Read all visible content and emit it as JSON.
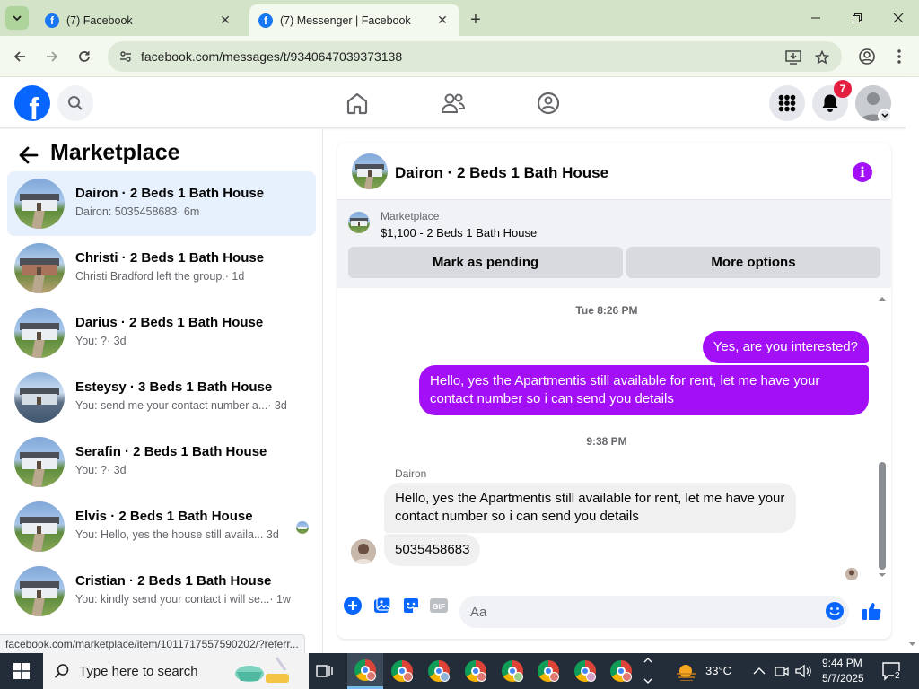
{
  "browser": {
    "tabs": [
      {
        "title": "(7) Facebook",
        "active": false
      },
      {
        "title": "(7) Messenger | Facebook",
        "active": true
      }
    ],
    "url_host": "facebook.com",
    "url_path": "/messages/t/9340647039373138",
    "status_url": "facebook.com/marketplace/item/1011717557590202/?referr..."
  },
  "fb_header": {
    "logo_letter": "f",
    "notifications_count": "7"
  },
  "left_panel": {
    "title": "Marketplace",
    "conversations": [
      {
        "name": "Dairon · 2 Beds 1 Bath House",
        "preview": "Dairon: 5035458683",
        "time": "· 6m",
        "active": true,
        "thumb": "house"
      },
      {
        "name": "Christi · 2 Beds 1 Bath House",
        "preview": "Christi Bradford left the group.",
        "time": "· 1d",
        "active": false,
        "thumb": "house-brown"
      },
      {
        "name": "Darius · 2 Beds 1 Bath House",
        "preview": "You: ?",
        "time": "· 3d",
        "active": false,
        "thumb": "house"
      },
      {
        "name": "Esteysy · 3 Beds 1 Bath House",
        "preview": "You: send me your contact number a...",
        "time": "· 3d",
        "active": false,
        "thumb": "house-pool"
      },
      {
        "name": "Serafin · 2 Beds 1 Bath House",
        "preview": "You: ?",
        "time": "· 3d",
        "active": false,
        "thumb": "house"
      },
      {
        "name": "Elvis · 2 Beds 1 Bath House",
        "preview": "You: Hello, yes the house still availa...",
        "time": "3d",
        "active": false,
        "thumb": "house"
      },
      {
        "name": "Cristian · 2 Beds 1 Bath House",
        "preview": "You: kindly send your contact i will se...",
        "time": "· 1w",
        "active": false,
        "thumb": "house"
      }
    ]
  },
  "chat": {
    "title": "Dairon · 2 Beds 1 Bath House",
    "listing_category": "Marketplace",
    "listing_title": "$1,100 - 2 Beds 1 Bath House",
    "mark_pending_label": "Mark as pending",
    "more_options_label": "More options",
    "timestamp_1": "Tue 8:26 PM",
    "msg_out_1": "Yes, are you interested?",
    "msg_out_2": "Hello, yes the Apartmentis still available for rent, let me have your contact number so i can send you  details",
    "timestamp_2": "9:38 PM",
    "sender_name": "Dairon",
    "msg_in_1": "Hello, yes the Apartmentis still available for rent, let me have your contact number so i can send you  details",
    "msg_in_2": "5035458683",
    "input_placeholder": "Aa",
    "gif_label": "GIF",
    "accent_color": "#a30ff7"
  },
  "taskbar": {
    "search_placeholder": "Type here to search",
    "temperature": "33°C",
    "time": "9:44 PM",
    "date": "5/7/2025",
    "notification_count": "2"
  }
}
